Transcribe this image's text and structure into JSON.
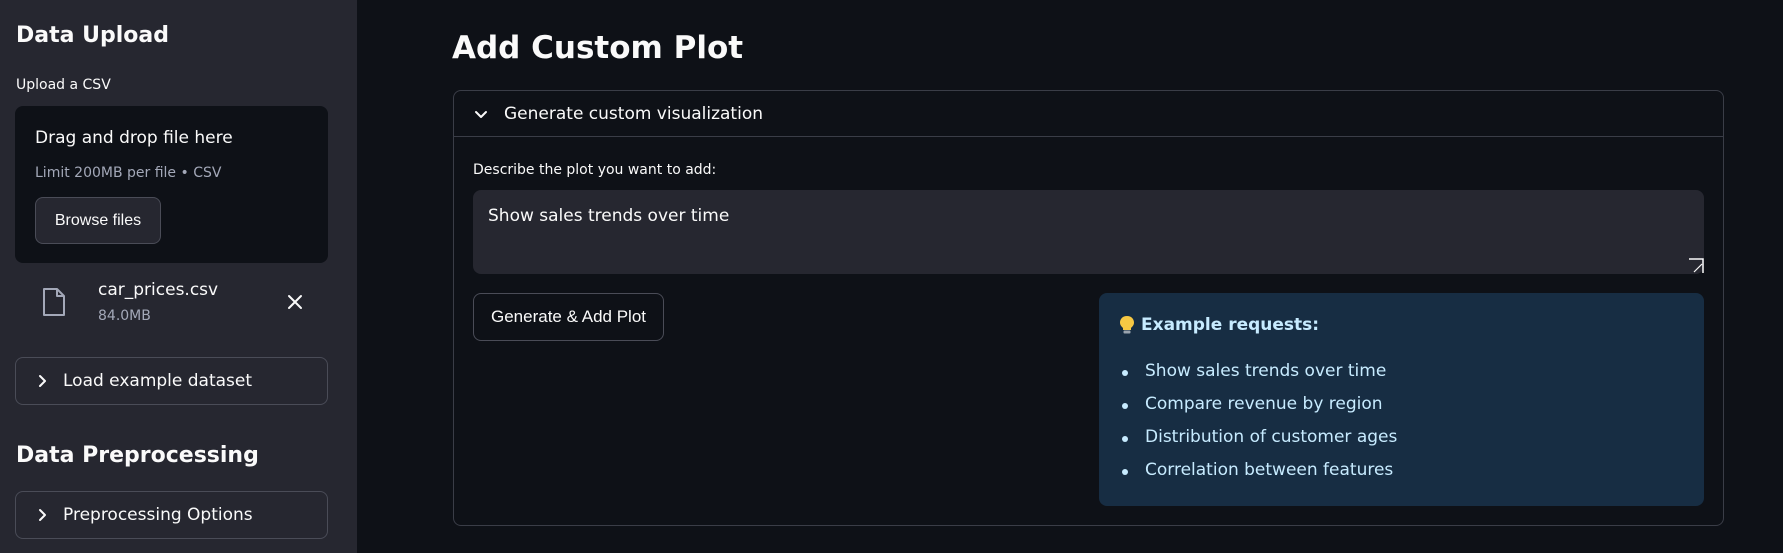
{
  "sidebar": {
    "upload_heading": "Data Upload",
    "upload_label": "Upload a CSV",
    "dropzone": {
      "title": "Drag and drop file here",
      "subtitle": "Limit 200MB per file • CSV",
      "browse_label": "Browse files"
    },
    "file": {
      "name": "car_prices.csv",
      "size": "84.0MB",
      "icon": "file-icon"
    },
    "load_example_label": "Load example dataset",
    "preprocessing_heading": "Data Preprocessing",
    "preprocessing_options_label": "Preprocessing Options"
  },
  "main": {
    "title": "Add Custom Plot",
    "expander_label": "Generate custom visualization",
    "field_label": "Describe the plot you want to add:",
    "field_value": "Show sales trends over time",
    "generate_button_label": "Generate & Add Plot",
    "examples": {
      "title": "Example requests:",
      "icon": "lightbulb-icon",
      "items": [
        "Show sales trends over time",
        "Compare revenue by region",
        "Distribution of customer ages",
        "Correlation between features"
      ]
    }
  },
  "colors": {
    "background": "#0e1117",
    "sidebar": "#262730",
    "info_bg": "#172d43",
    "info_text": "#c7ebff"
  }
}
